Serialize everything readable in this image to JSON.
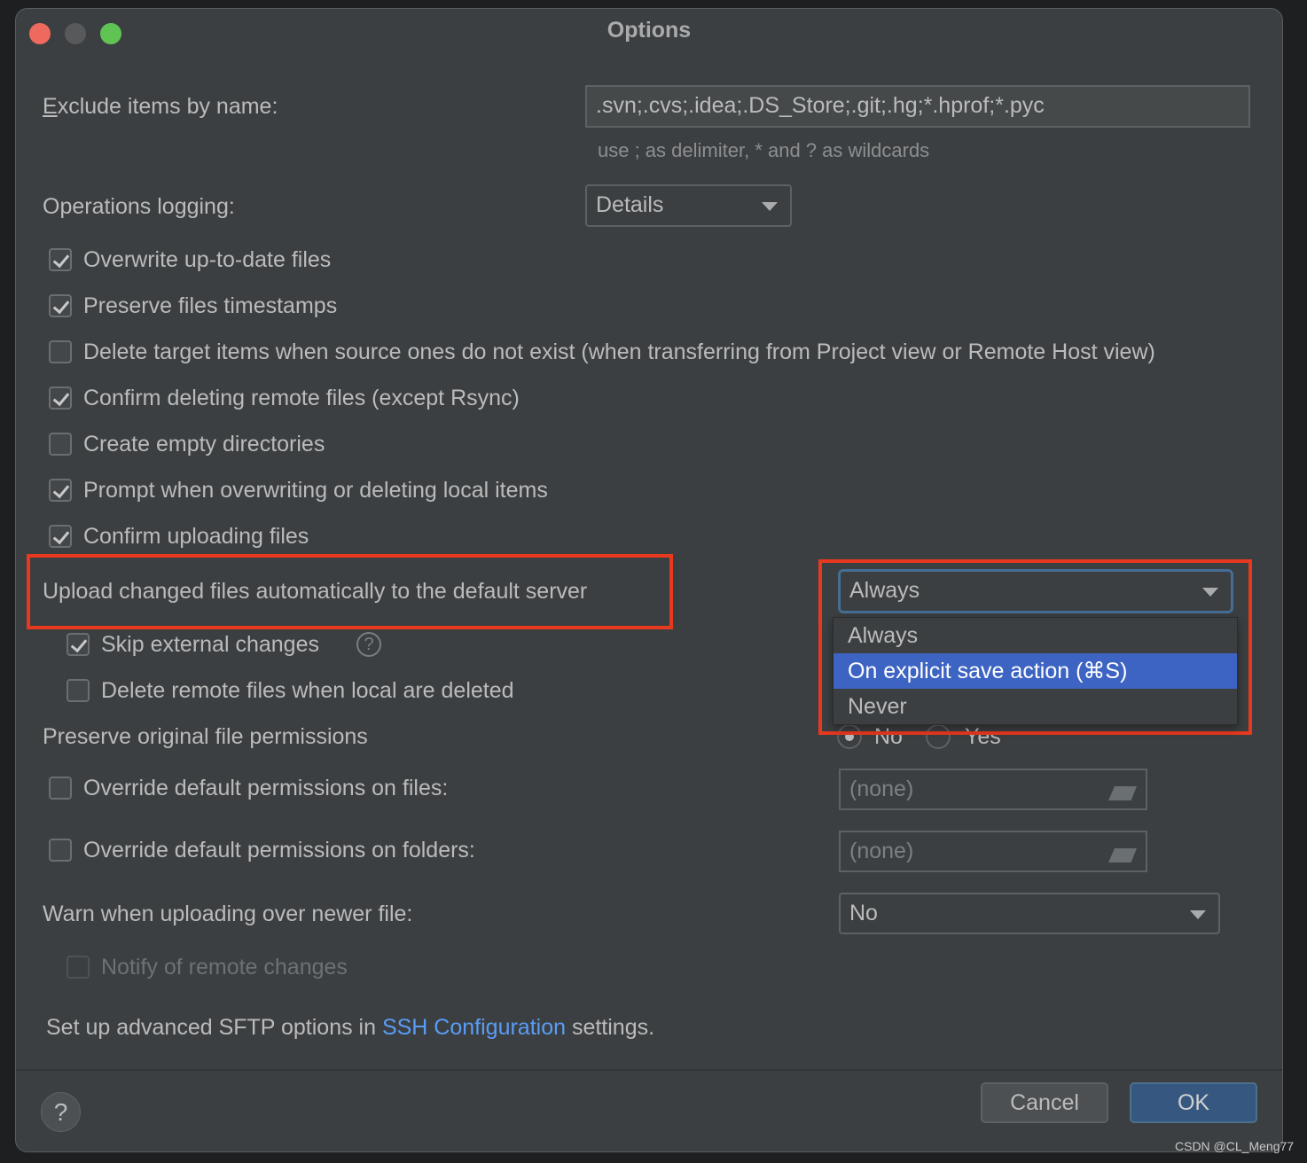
{
  "window": {
    "title": "Options"
  },
  "exclude": {
    "label_first": "E",
    "label_rest": "xclude items by name:",
    "value": ".svn;.cvs;.idea;.DS_Store;.git;.hg;*.hprof;*.pyc",
    "hint": "use ; as delimiter, * and ? as wildcards"
  },
  "logging": {
    "label": "Operations logging:",
    "value": "Details"
  },
  "checkboxes": [
    {
      "label": "Overwrite up-to-date files",
      "checked": true
    },
    {
      "label": "Preserve files timestamps",
      "checked": true
    },
    {
      "label": "Delete target items when source ones do not exist (when transferring from Project view or Remote Host view)",
      "checked": false
    },
    {
      "label": "Confirm deleting remote files (except Rsync)",
      "checked": true
    },
    {
      "label": "Create empty directories",
      "checked": false
    },
    {
      "label": "Prompt when overwriting or deleting local items",
      "checked": true
    },
    {
      "label": "Confirm uploading files",
      "checked": true
    }
  ],
  "upload": {
    "label": "Upload changed files automatically to the default server",
    "value": "Always",
    "options": [
      "Always",
      "On explicit save action (⌘S)",
      "Never"
    ],
    "highlighted": "On explicit save action (⌘S)"
  },
  "skip_external": {
    "label": "Skip external changes",
    "checked": true,
    "help": "?"
  },
  "delete_remote": {
    "label": "Delete remote files when local are deleted",
    "checked": false
  },
  "preserve_perm": {
    "label": "Preserve original file permissions",
    "options": [
      "No",
      "Yes"
    ],
    "selected": "No"
  },
  "perm_files": {
    "label": "Override default permissions on files:",
    "value": "(none)",
    "checked": false
  },
  "perm_folders": {
    "label": "Override default permissions on folders:",
    "value": "(none)",
    "checked": false
  },
  "warn": {
    "label": "Warn when uploading over newer file:",
    "value": "No"
  },
  "notify": {
    "label": "Notify of remote changes",
    "checked": false,
    "disabled": true
  },
  "sftp": {
    "prefix": "Set up advanced SFTP options in ",
    "link": "SSH Configuration",
    "suffix": " settings."
  },
  "footer": {
    "help": "?",
    "cancel": "Cancel",
    "ok": "OK"
  },
  "watermark": "CSDN @CL_Meng77",
  "colors": {
    "background": "#3c3f41",
    "accent": "#3d64c3",
    "link": "#589df6",
    "annotation": "#e8391f"
  }
}
